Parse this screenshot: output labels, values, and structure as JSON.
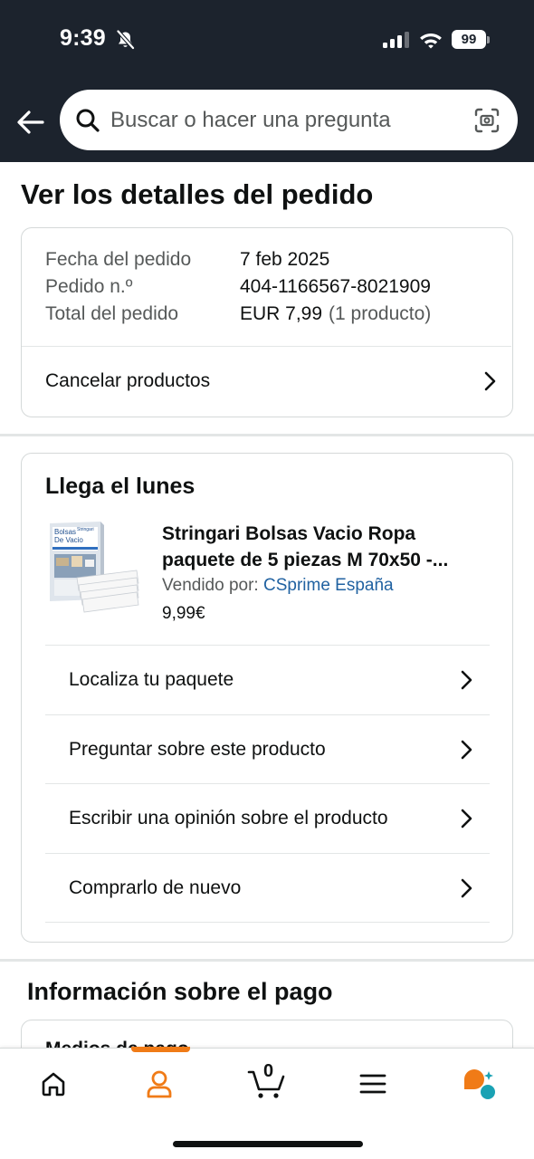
{
  "status_bar": {
    "time": "9:39",
    "battery": "99"
  },
  "header": {
    "search_placeholder": "Buscar o hacer una pregunta"
  },
  "page_title": "Ver los detalles del pedido",
  "order_summary": {
    "rows": [
      {
        "label": "Fecha del pedido",
        "value": "7 feb 2025",
        "extra": ""
      },
      {
        "label": "Pedido n.º",
        "value": "404-1166567-8021909",
        "extra": ""
      },
      {
        "label": "Total del pedido",
        "value": "EUR 7,99",
        "extra": "(1 producto)"
      }
    ],
    "cancel_label": "Cancelar productos"
  },
  "delivery": {
    "title": "Llega el lunes",
    "product": {
      "title": "Stringari Bolsas Vacio Ropa paquete de 5 piezas M 70x50 -...",
      "seller_prefix": "Vendido por:",
      "seller_name": "CSprime España",
      "price": "9,99€",
      "image_text": {
        "line1": "Bolsas",
        "line2": "De Vacio",
        "brand": "Stringari"
      }
    },
    "actions": [
      {
        "label": "Localiza tu paquete"
      },
      {
        "label": "Preguntar sobre este producto"
      },
      {
        "label": "Escribir una opinión sobre el producto"
      },
      {
        "label": "Comprarlo de nuevo"
      }
    ]
  },
  "payment": {
    "title": "Información sobre el pago",
    "card_label": "Medios de pago"
  },
  "tabbar": {
    "active": "account",
    "cart_count": "0",
    "tabs": [
      "home-icon",
      "account-icon",
      "cart-icon",
      "menu-icon",
      "rufus-icon"
    ]
  },
  "colors": {
    "header_bg": "#1c232d",
    "accent": "#f07b17",
    "link": "#2162a1",
    "border": "#d5d9d9"
  }
}
